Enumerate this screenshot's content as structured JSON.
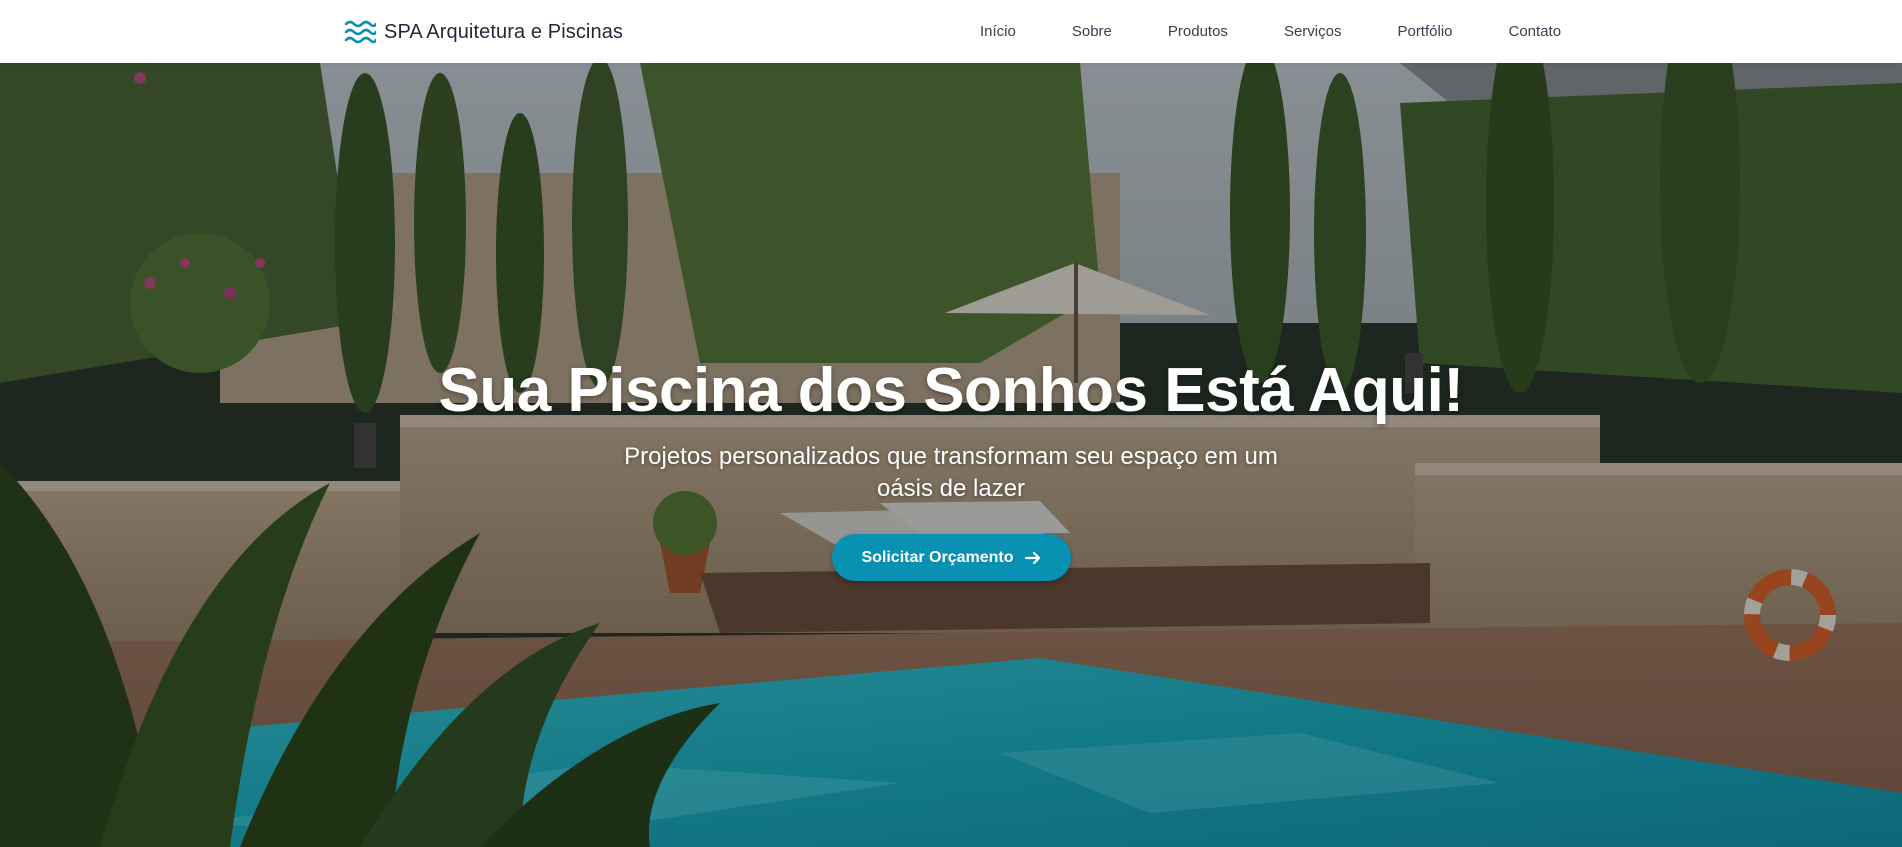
{
  "brand": {
    "name": "SPA Arquitetura e Piscinas",
    "icon": "waves-icon",
    "color": "#0891b2"
  },
  "nav": {
    "items": [
      "Início",
      "Sobre",
      "Produtos",
      "Serviços",
      "Portfólio",
      "Contato"
    ]
  },
  "hero": {
    "title": "Sua Piscina dos Sonhos Está Aqui!",
    "subtitle": "Projetos personalizados que transformam seu espaço em um oásis de lazer",
    "cta_label": "Solicitar Orçamento",
    "cta_icon": "arrow-right-icon",
    "background": "pool-garden-photo",
    "accent": "#0891b2"
  }
}
